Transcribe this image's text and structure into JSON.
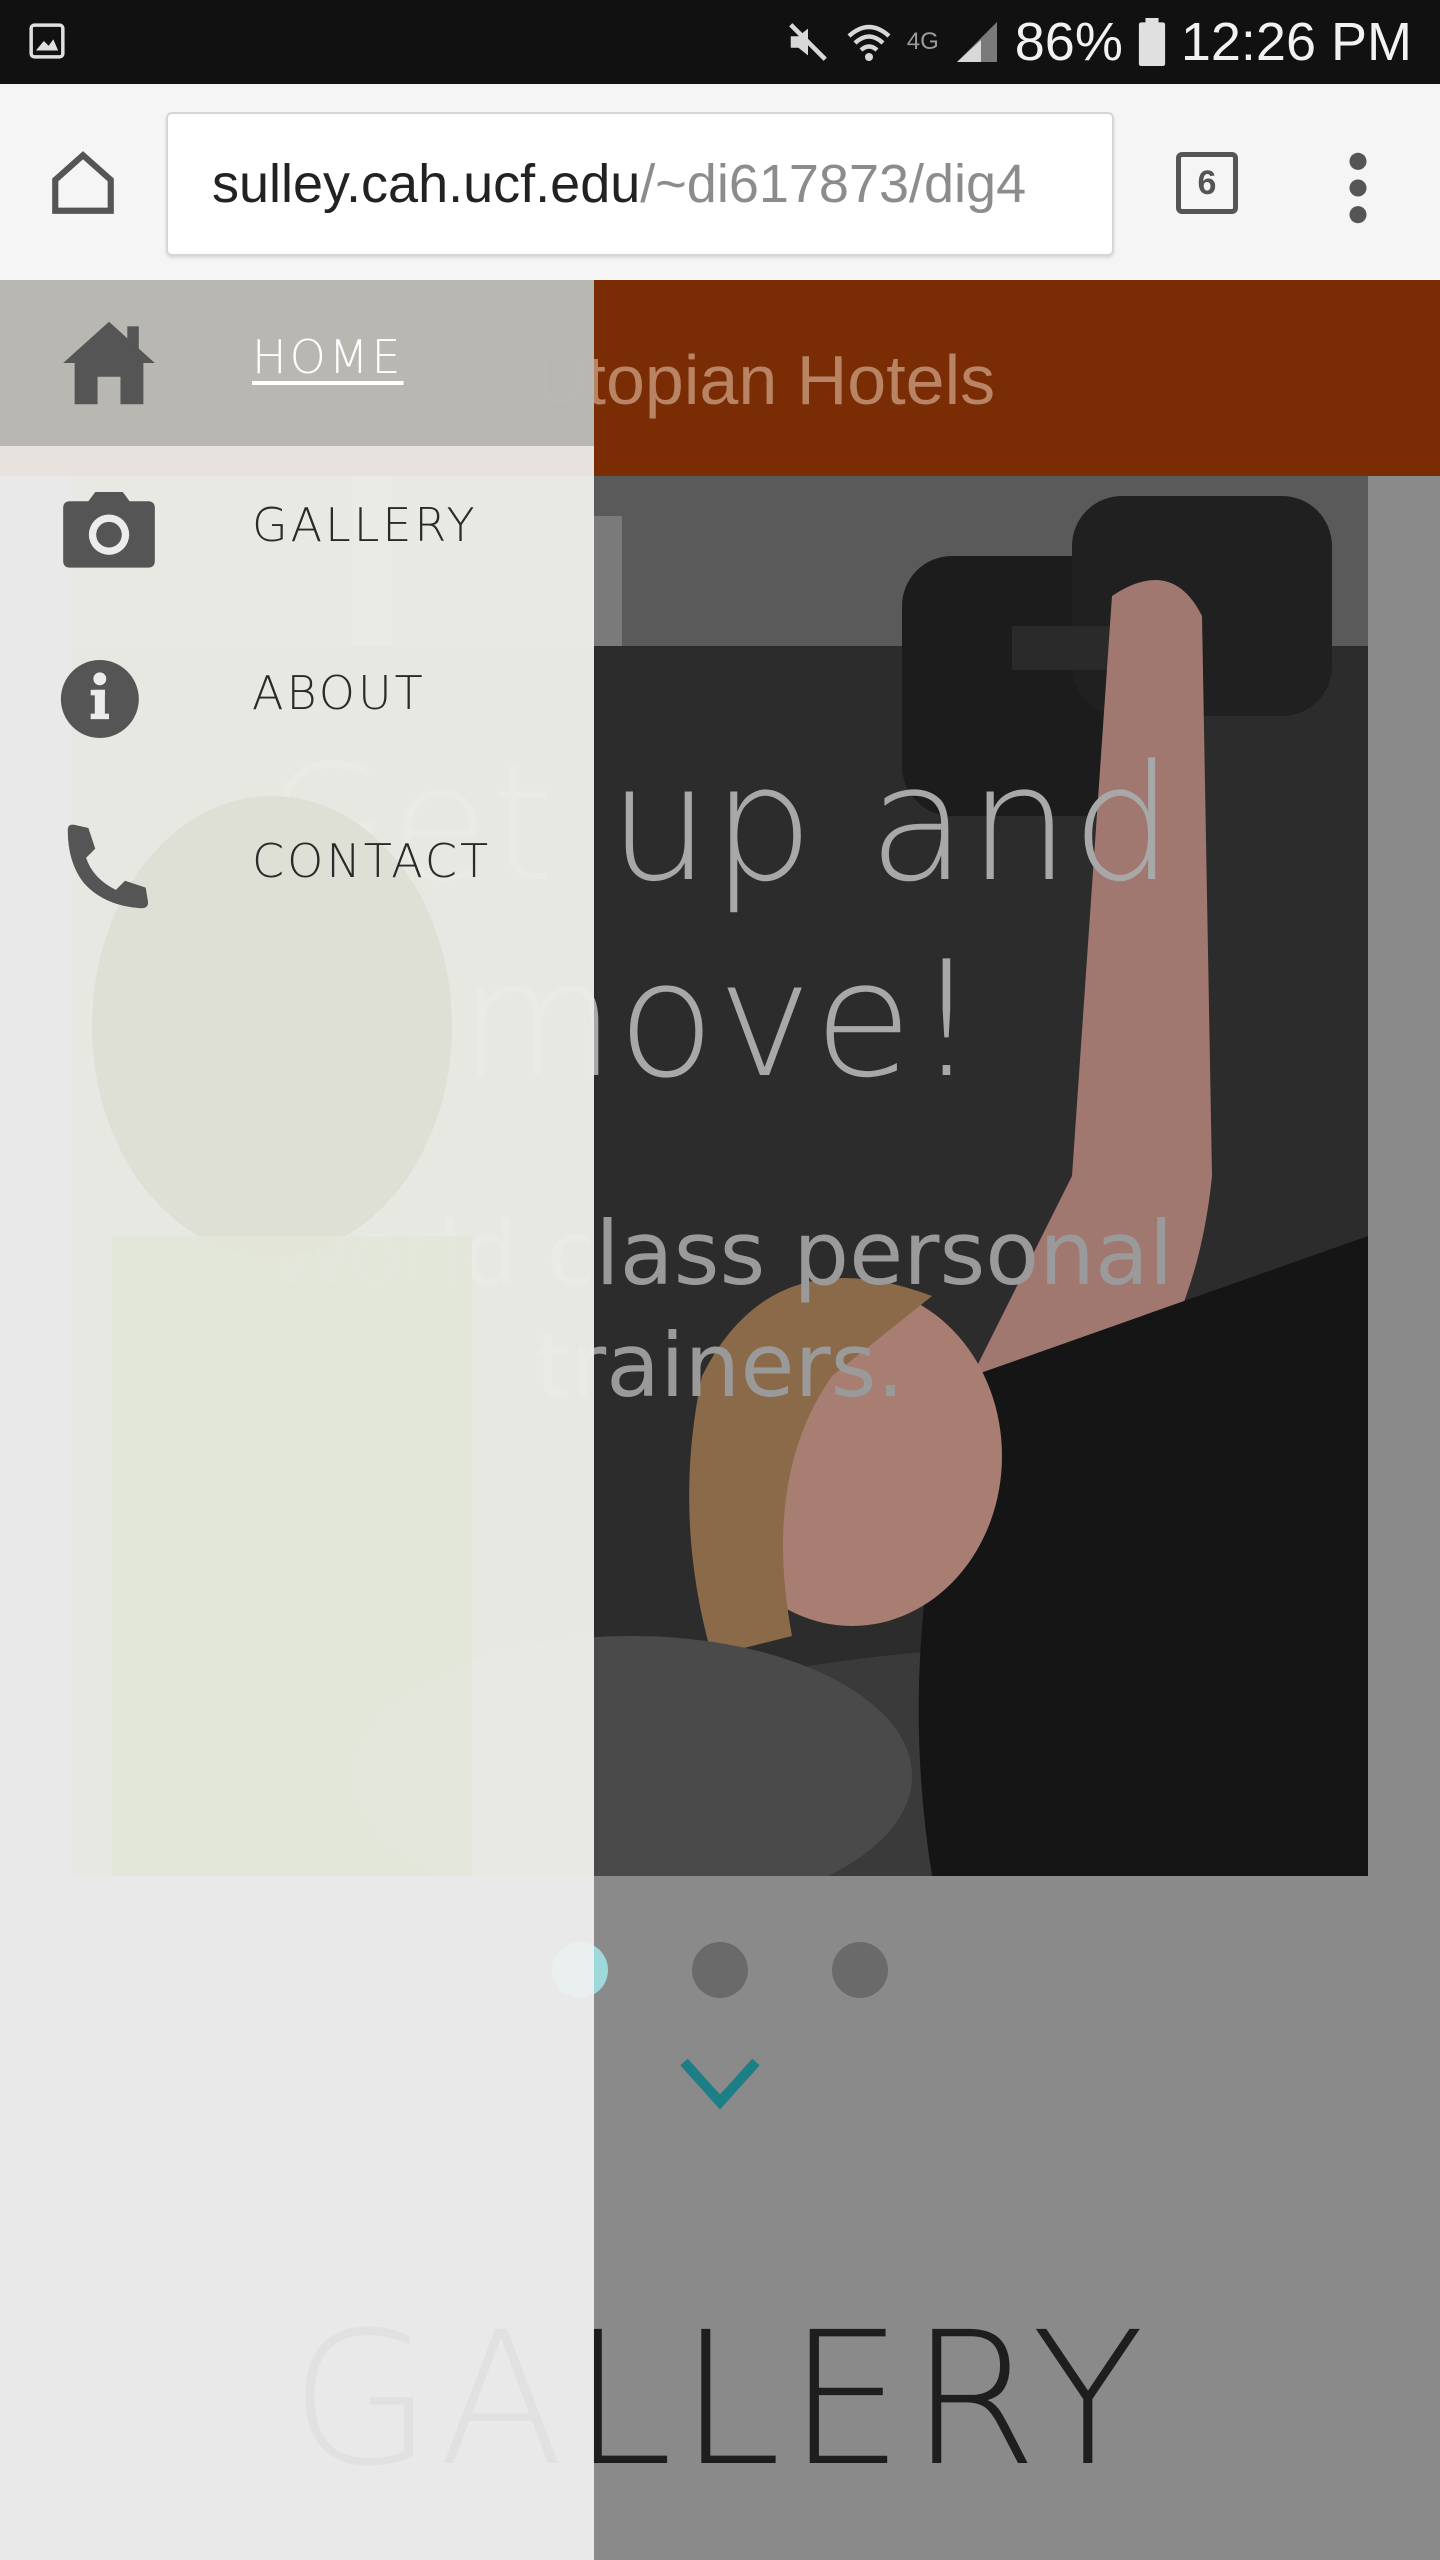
{
  "status_bar": {
    "battery": "86%",
    "time": "12:26 PM",
    "network": "4G"
  },
  "browser": {
    "url_host": "sulley.cah.ucf.edu",
    "url_path": "/~di617873/dig4",
    "tab_count": "6"
  },
  "site": {
    "title": "Utopian Hotels",
    "header_color": "#7a2c05"
  },
  "hero": {
    "heading": "Get up and move!",
    "subheading": "World class personal trainers."
  },
  "slider": {
    "dot_count": 3,
    "active_index": 0
  },
  "sections": {
    "gallery_heading": "GALLERY"
  },
  "drawer": {
    "items": [
      {
        "label": "HOME",
        "icon": "home-icon",
        "active": true
      },
      {
        "label": "GALLERY",
        "icon": "camera-icon",
        "active": false
      },
      {
        "label": "ABOUT",
        "icon": "info-icon",
        "active": false
      },
      {
        "label": "CONTACT",
        "icon": "phone-icon",
        "active": false
      }
    ]
  },
  "colors": {
    "accent_teal": "#1d7f86",
    "drawer_bg": "#efefef",
    "active_item_bg": "#b2b0ac"
  }
}
